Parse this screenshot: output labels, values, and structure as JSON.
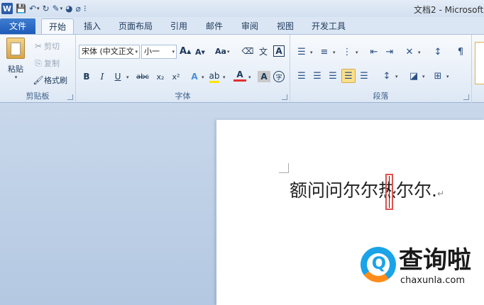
{
  "window": {
    "title": "文档2 - Microsoft"
  },
  "qat": {
    "logo": "W",
    "icons": [
      "save-icon",
      "undo-icon",
      "redo-icon",
      "format-painter-icon",
      "color-icon",
      "clear-icon"
    ]
  },
  "tabs": [
    {
      "label": "文件"
    },
    {
      "label": "开始"
    },
    {
      "label": "插入"
    },
    {
      "label": "页面布局"
    },
    {
      "label": "引用"
    },
    {
      "label": "邮件"
    },
    {
      "label": "审阅"
    },
    {
      "label": "视图"
    },
    {
      "label": "开发工具"
    }
  ],
  "clipboard": {
    "label": "剪贴板",
    "paste": "粘贴",
    "cut": "剪切",
    "copy": "复制",
    "format_painter": "格式刷"
  },
  "font": {
    "label": "字体",
    "font_name": "宋体 (中文正文",
    "font_size": "小一",
    "grow": "A",
    "shrink": "A",
    "change_case": "Aa",
    "bold": "B",
    "italic": "I",
    "underline": "U",
    "strike": "abc",
    "subscript": "x₂",
    "superscript": "x²",
    "text_effect": "A",
    "font_color": "A",
    "char_shading": "A",
    "enclose": "字"
  },
  "paragraph": {
    "label": "段落"
  },
  "document": {
    "text": "额问问尔尔热尔尔.",
    "paragraph_mark": "↵"
  },
  "watermark": {
    "brand_cn": "查询啦",
    "brand_en": "chaxunla.com"
  }
}
